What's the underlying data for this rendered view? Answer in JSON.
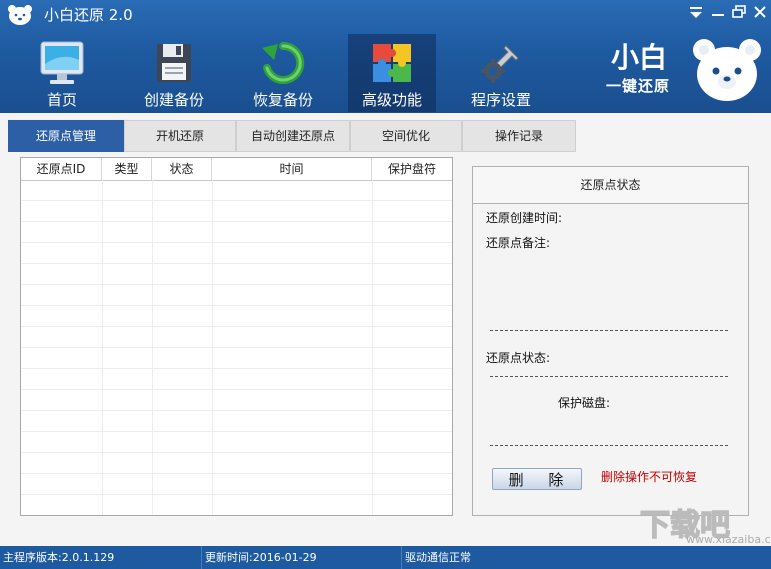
{
  "app": {
    "title": "小白还原 2.0",
    "icons": {
      "logo": "bear-logo-icon",
      "minimize": "minimize-icon",
      "menu": "dropdown-menu-icon",
      "restore": "restore-window-icon",
      "close": "close-icon"
    }
  },
  "toolbar": {
    "items": [
      {
        "label": "首页",
        "icon": "monitor-icon"
      },
      {
        "label": "创建备份",
        "icon": "floppy-disk-icon"
      },
      {
        "label": "恢复备份",
        "icon": "restore-arrow-icon"
      },
      {
        "label": "高级功能",
        "icon": "puzzle-icon"
      },
      {
        "label": "程序设置",
        "icon": "wrench-gear-icon"
      }
    ],
    "active_index": 3
  },
  "brand": {
    "name": "小白",
    "subtitle": "一键还原"
  },
  "tabs": [
    {
      "label": "还原点管理",
      "active": true
    },
    {
      "label": "开机还原",
      "active": false
    },
    {
      "label": "自动创建还原点",
      "active": false
    },
    {
      "label": "空间优化",
      "active": false
    },
    {
      "label": "操作记录",
      "active": false
    }
  ],
  "restore_table": {
    "columns": [
      "还原点ID",
      "类型",
      "状态",
      "时间",
      "保护盘符"
    ],
    "rows": []
  },
  "status_panel": {
    "title": "还原点状态",
    "created_time_label": "还原创建时间:",
    "note_label": "还原点备注:",
    "state_label": "还原点状态:",
    "protected_disk_label": "保护磁盘:",
    "delete_button": "删 除",
    "delete_warning": "删除操作不可恢复"
  },
  "statusbar": {
    "version": "主程序版本:2.0.1.129",
    "update_time": "更新时间:2016-01-29",
    "driver_status": "驱动通信正常"
  },
  "watermark": {
    "text": "下载吧",
    "url": "www.xiazaiba.com"
  },
  "colors": {
    "header_blue": "#1e5aa0",
    "active_tab": "#2c5fa6",
    "warning_red": "#c00000"
  }
}
